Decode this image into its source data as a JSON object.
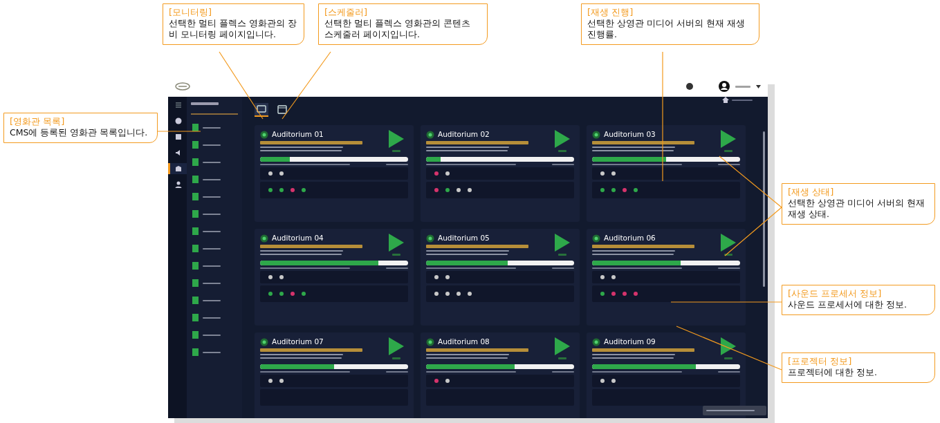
{
  "callouts": [
    {
      "title": "[모니터링]",
      "text": "선택한 멀티 플렉스 영화관의 장비 모니터링 페이지입니다."
    },
    {
      "title": "[스케줄러]",
      "text": "선택한 멀티 플렉스 영화관의 콘텐츠 스케줄러 페이지입니다."
    },
    {
      "title": "[재생 진행]",
      "text": "선택한 상영관 미디어 서버의 현재 재생 진행률."
    },
    {
      "title": "[영화관 목록]",
      "text": "CMS에 등록된 영화관 목록입니다."
    },
    {
      "title": "[재생 상태]",
      "text": "선택한 상영관 미디어 서버의 현재 재생 상태."
    },
    {
      "title": "[사운드 프로세서 정보]",
      "text": "사운드 프로세서에 대한 정보."
    },
    {
      "title": "[프로젝터 정보]",
      "text": "프로젝터에 대한 정보."
    }
  ],
  "app": {
    "rail": [
      {
        "kind": "menu",
        "selected": false
      },
      {
        "kind": "gauge",
        "selected": false
      },
      {
        "kind": "calendar",
        "selected": false
      },
      {
        "kind": "speaker",
        "selected": false
      },
      {
        "kind": "building",
        "selected": true
      },
      {
        "kind": "user",
        "selected": false
      }
    ],
    "sidebar_items": [
      {
        "selected": false
      },
      {
        "selected": false
      },
      {
        "selected": false
      },
      {
        "selected": false
      },
      {
        "selected": false
      },
      {
        "selected": false
      },
      {
        "selected": false
      },
      {
        "selected": false
      },
      {
        "selected": false
      },
      {
        "selected": false
      },
      {
        "selected": false
      },
      {
        "selected": false
      },
      {
        "selected": false
      },
      {
        "selected": false
      }
    ],
    "tabs": [
      {
        "kind": "monitor",
        "selected": true
      },
      {
        "kind": "calendar",
        "selected": false
      }
    ],
    "cards": [
      {
        "title": "Auditorium 01",
        "level": 0.2,
        "sound": [
          {
            "color": "#c8c8c8"
          },
          {
            "color": "#c8c8c8"
          }
        ],
        "projector": [
          {
            "color": "#2ea84a"
          },
          {
            "color": "#2ea84a"
          },
          {
            "color": "#d6336c"
          },
          {
            "color": "#2ea84a"
          }
        ]
      },
      {
        "title": "Auditorium 02",
        "level": 0.1,
        "sound": [
          {
            "color": "#d6336c"
          },
          {
            "color": "#c8c8c8"
          }
        ],
        "projector": [
          {
            "color": "#d6336c"
          },
          {
            "color": "#2ea84a"
          },
          {
            "color": "#c8c8c8"
          },
          {
            "color": "#c8c8c8"
          }
        ]
      },
      {
        "title": "Auditorium 03",
        "level": 0.5,
        "sound": [
          {
            "color": "#c8c8c8"
          },
          {
            "color": "#c8c8c8"
          }
        ],
        "projector": [
          {
            "color": "#2ea84a"
          },
          {
            "color": "#2ea84a"
          },
          {
            "color": "#d6336c"
          },
          {
            "color": "#2ea84a"
          }
        ]
      },
      {
        "title": "Auditorium 04",
        "level": 0.8,
        "sound": [
          {
            "color": "#c8c8c8"
          },
          {
            "color": "#c8c8c8"
          }
        ],
        "projector": [
          {
            "color": "#2ea84a"
          },
          {
            "color": "#2ea84a"
          },
          {
            "color": "#d6336c"
          },
          {
            "color": "#2ea84a"
          }
        ]
      },
      {
        "title": "Auditorium 05",
        "level": 0.55,
        "sound": [
          {
            "color": "#c8c8c8"
          },
          {
            "color": "#c8c8c8"
          }
        ],
        "projector": [
          {
            "color": "#c8c8c8"
          },
          {
            "color": "#c8c8c8"
          },
          {
            "color": "#c8c8c8"
          },
          {
            "color": "#c8c8c8"
          }
        ]
      },
      {
        "title": "Auditorium 06",
        "level": 0.6,
        "sound": [
          {
            "color": "#c8c8c8"
          },
          {
            "color": "#c8c8c8"
          }
        ],
        "projector": [
          {
            "color": "#2ea84a"
          },
          {
            "color": "#d6336c"
          },
          {
            "color": "#d6336c"
          },
          {
            "color": "#d6336c"
          }
        ]
      },
      {
        "title": "Auditorium 07",
        "level": 0.5,
        "sound": [
          {
            "color": "#c8c8c8"
          },
          {
            "color": "#c8c8c8"
          }
        ]
      },
      {
        "title": "Auditorium 08",
        "level": 0.6,
        "sound": [
          {
            "color": "#d6336c"
          },
          {
            "color": "#c8c8c8"
          }
        ]
      },
      {
        "title": "Auditorium 09",
        "level": 0.7,
        "sound": [
          {
            "color": "#c8c8c8"
          },
          {
            "color": "#c8c8c8"
          }
        ]
      }
    ]
  }
}
